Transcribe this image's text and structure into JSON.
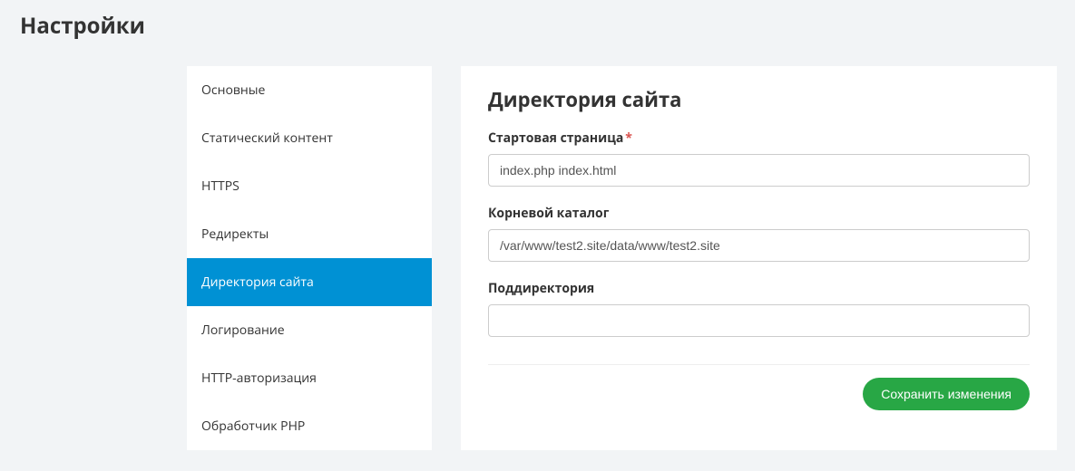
{
  "page_title": "Настройки",
  "sidebar": {
    "items": [
      {
        "label": "Основные",
        "active": false
      },
      {
        "label": "Статический контент",
        "active": false
      },
      {
        "label": "HTTPS",
        "active": false
      },
      {
        "label": "Редиректы",
        "active": false
      },
      {
        "label": "Директория сайта",
        "active": true
      },
      {
        "label": "Логирование",
        "active": false
      },
      {
        "label": "HTTP-авторизация",
        "active": false
      },
      {
        "label": "Обработчик PHP",
        "active": false
      }
    ]
  },
  "content": {
    "title": "Директория сайта",
    "fields": {
      "start_page": {
        "label": "Стартовая страница",
        "required": true,
        "value": "index.php index.html"
      },
      "root_dir": {
        "label": "Корневой каталог",
        "required": false,
        "value": "/var/www/test2.site/data/www/test2.site"
      },
      "sub_dir": {
        "label": "Поддиректория",
        "required": false,
        "value": ""
      }
    },
    "save_label": "Сохранить изменения"
  }
}
